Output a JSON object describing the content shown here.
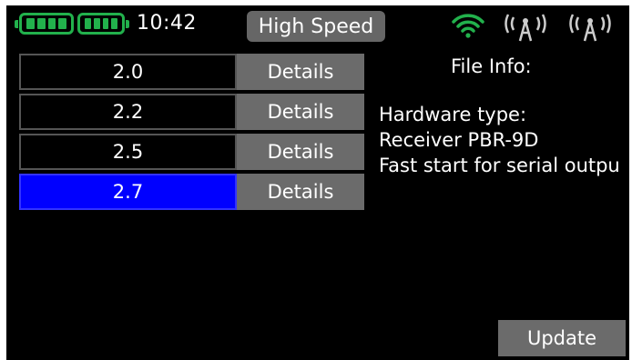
{
  "status_bar": {
    "battery_1_icon": "battery-full-icon",
    "battery_2_icon": "battery-full-icon",
    "time": "10:42",
    "mode": "High Speed",
    "wifi_icon": "wifi-icon",
    "antenna_icon": "antenna-signal-icon",
    "accent_color": "#22b14c"
  },
  "firmware_list": [
    {
      "version": "2.0",
      "details_label": "Details",
      "selected": false
    },
    {
      "version": "2.2",
      "details_label": "Details",
      "selected": false
    },
    {
      "version": "2.5",
      "details_label": "Details",
      "selected": false
    },
    {
      "version": "2.7",
      "details_label": "Details",
      "selected": true
    }
  ],
  "file_info": {
    "title": "File Info:",
    "line_1": "Hardware type:",
    "line_2": "Receiver PBR-9D",
    "line_3": "Fast start for serial outpu"
  },
  "actions": {
    "update_label": "Update"
  },
  "colors": {
    "selected_row": "#0000ff",
    "button_bg": "#6b6b6b"
  }
}
